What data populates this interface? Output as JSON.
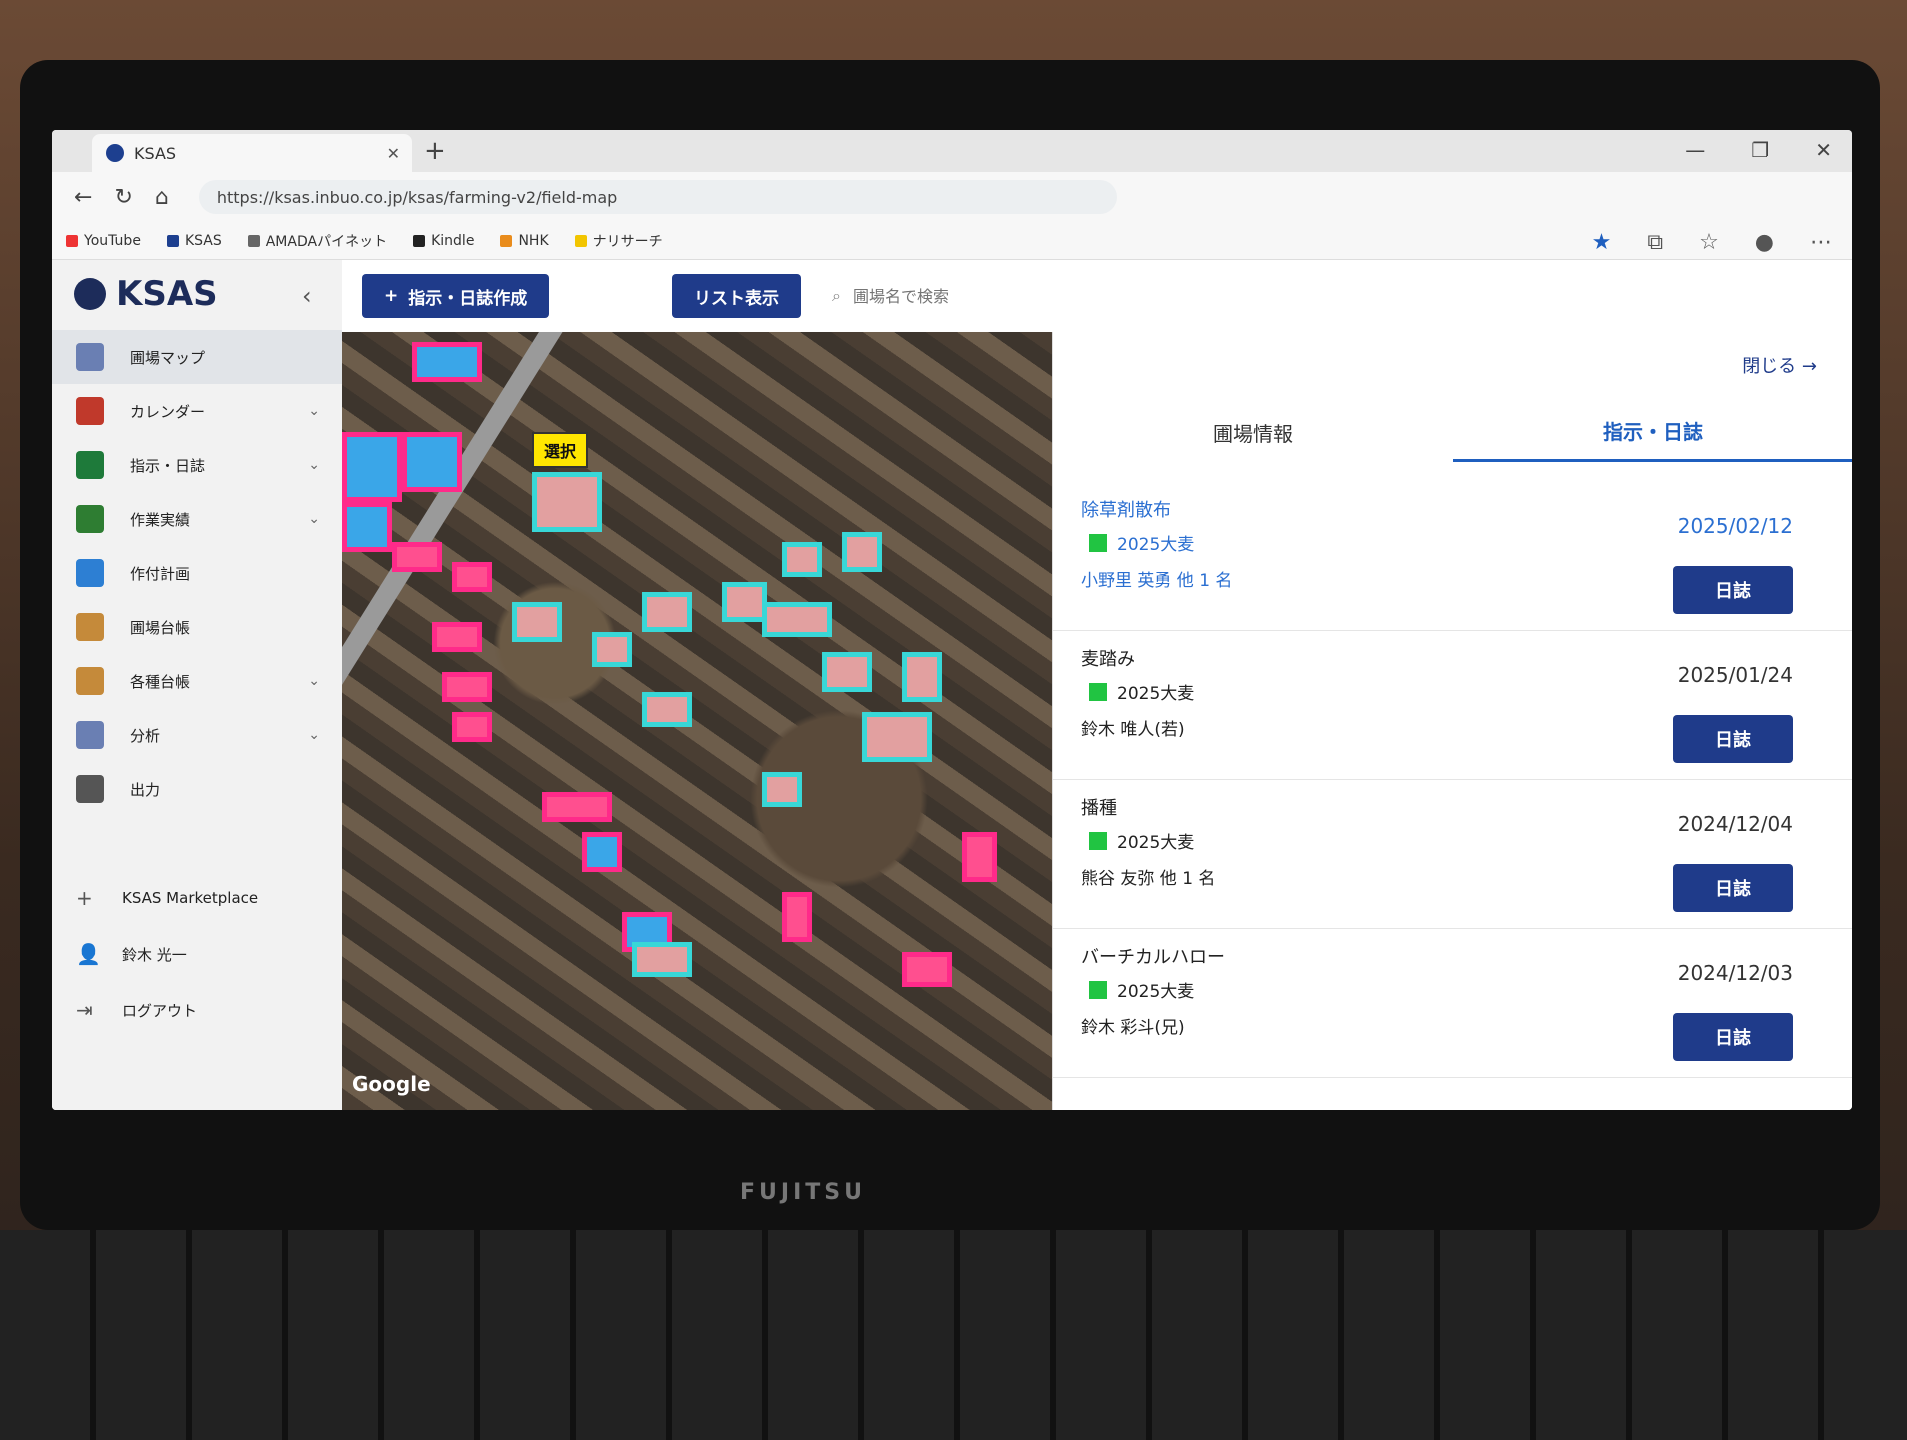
{
  "browser": {
    "tab_title": "KSAS",
    "url": "https://ksas.inbuo.co.jp/ksas/farming-v2/field-map",
    "bookmarks": [
      "YouTube",
      "KSAS",
      "AMADAパイネット",
      "Kindle",
      "NHK",
      "ナリサーチ"
    ]
  },
  "app": {
    "logo": "KSAS",
    "collapse_icon": "‹",
    "menu": [
      {
        "label": "圃場マップ",
        "color": "#6a7fb3",
        "chevron": "",
        "active": true
      },
      {
        "label": "カレンダー",
        "color": "#c0392b",
        "chevron": "⌄"
      },
      {
        "label": "指示・日誌",
        "color": "#1e7a3a",
        "chevron": "⌄"
      },
      {
        "label": "作業実績",
        "color": "#2e7d32",
        "chevron": "⌄"
      },
      {
        "label": "作付計画",
        "color": "#2d7fd3",
        "chevron": ""
      },
      {
        "label": "圃場台帳",
        "color": "#c58a3a",
        "chevron": ""
      },
      {
        "label": "各種台帳",
        "color": "#c58a3a",
        "chevron": "⌄"
      },
      {
        "label": "分析",
        "color": "#6a7fb3",
        "chevron": "⌄"
      },
      {
        "label": "出力",
        "color": "#555555",
        "chevron": ""
      }
    ],
    "marketplace": "KSAS Marketplace",
    "user": "鈴木 光一",
    "logout": "ログアウト"
  },
  "toolbar": {
    "create_label": "指示・日誌作成",
    "list_label": "リスト表示",
    "search_placeholder": "圃場名で検索"
  },
  "map": {
    "selected_label": "選択",
    "attribution": "Google"
  },
  "panel": {
    "close_label": "閉じる →",
    "tabs": [
      "圃場情報",
      "指示・日誌"
    ],
    "entries": [
      {
        "title": "除草剤散布",
        "crop": "2025大麦",
        "person": "小野里 英勇  他 1 名",
        "date": "2025/02/12",
        "button": "日誌"
      },
      {
        "title": "麦踏み",
        "crop": "2025大麦",
        "person": "鈴木  唯人(若)",
        "date": "2025/01/24",
        "button": "日誌"
      },
      {
        "title": "播種",
        "crop": "2025大麦",
        "person": "熊谷 友弥  他 1 名",
        "date": "2024/12/04",
        "button": "日誌"
      },
      {
        "title": "バーチカルハロー",
        "crop": "2025大麦",
        "person": "鈴木  彩斗(兄)",
        "date": "2024/12/03",
        "button": "日誌"
      }
    ]
  },
  "laptop_brand": "FUJITSU"
}
